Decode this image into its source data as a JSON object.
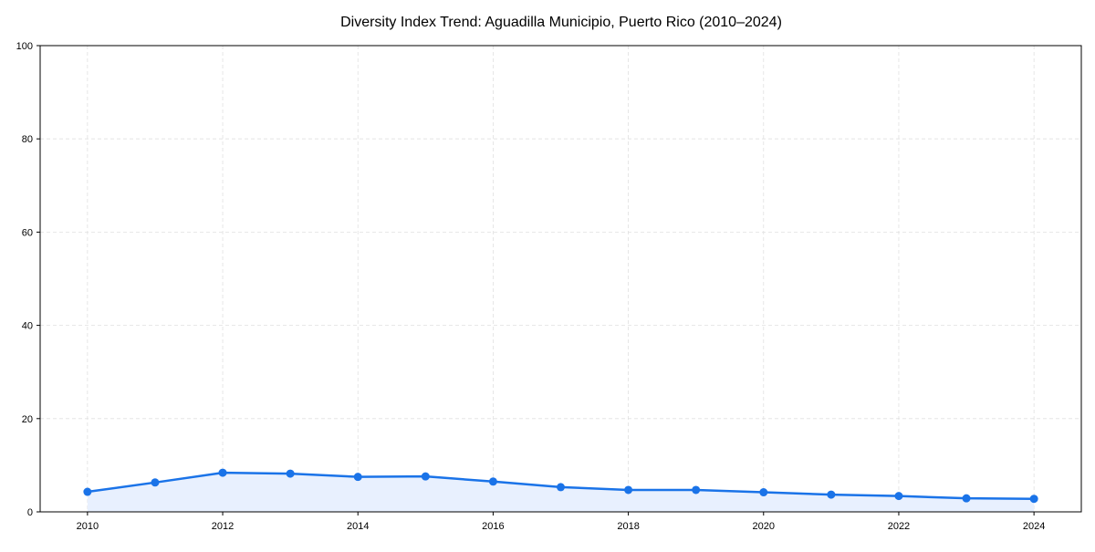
{
  "chart_data": {
    "type": "area",
    "title": "Diversity Index Trend: Aguadilla Municipio, Puerto Rico (2010–2024)",
    "xlabel": "",
    "ylabel": "",
    "x": [
      2010,
      2011,
      2012,
      2013,
      2014,
      2015,
      2016,
      2017,
      2018,
      2019,
      2020,
      2021,
      2022,
      2023,
      2024
    ],
    "series": [
      {
        "values": [
          4.3,
          6.3,
          8.4,
          8.2,
          7.5,
          7.6,
          6.5,
          5.3,
          4.7,
          4.7,
          4.2,
          3.7,
          3.4,
          2.9,
          2.8
        ]
      }
    ],
    "xlim": [
      2009.3,
      2024.7
    ],
    "ylim": [
      0,
      100
    ],
    "x_ticks": [
      "2010",
      "2012",
      "2014",
      "2016",
      "2018",
      "2020",
      "2022",
      "2024"
    ],
    "y_ticks": [
      "0",
      "20",
      "40",
      "60",
      "80",
      "100"
    ],
    "grid": true,
    "grid_style": "dashed",
    "legend": "none",
    "colors": {
      "line": "#1a73e8",
      "marker": "#1a73e8",
      "fill": "#e8f0fe",
      "grid": "#e0e0e0",
      "axis": "#000000"
    }
  }
}
